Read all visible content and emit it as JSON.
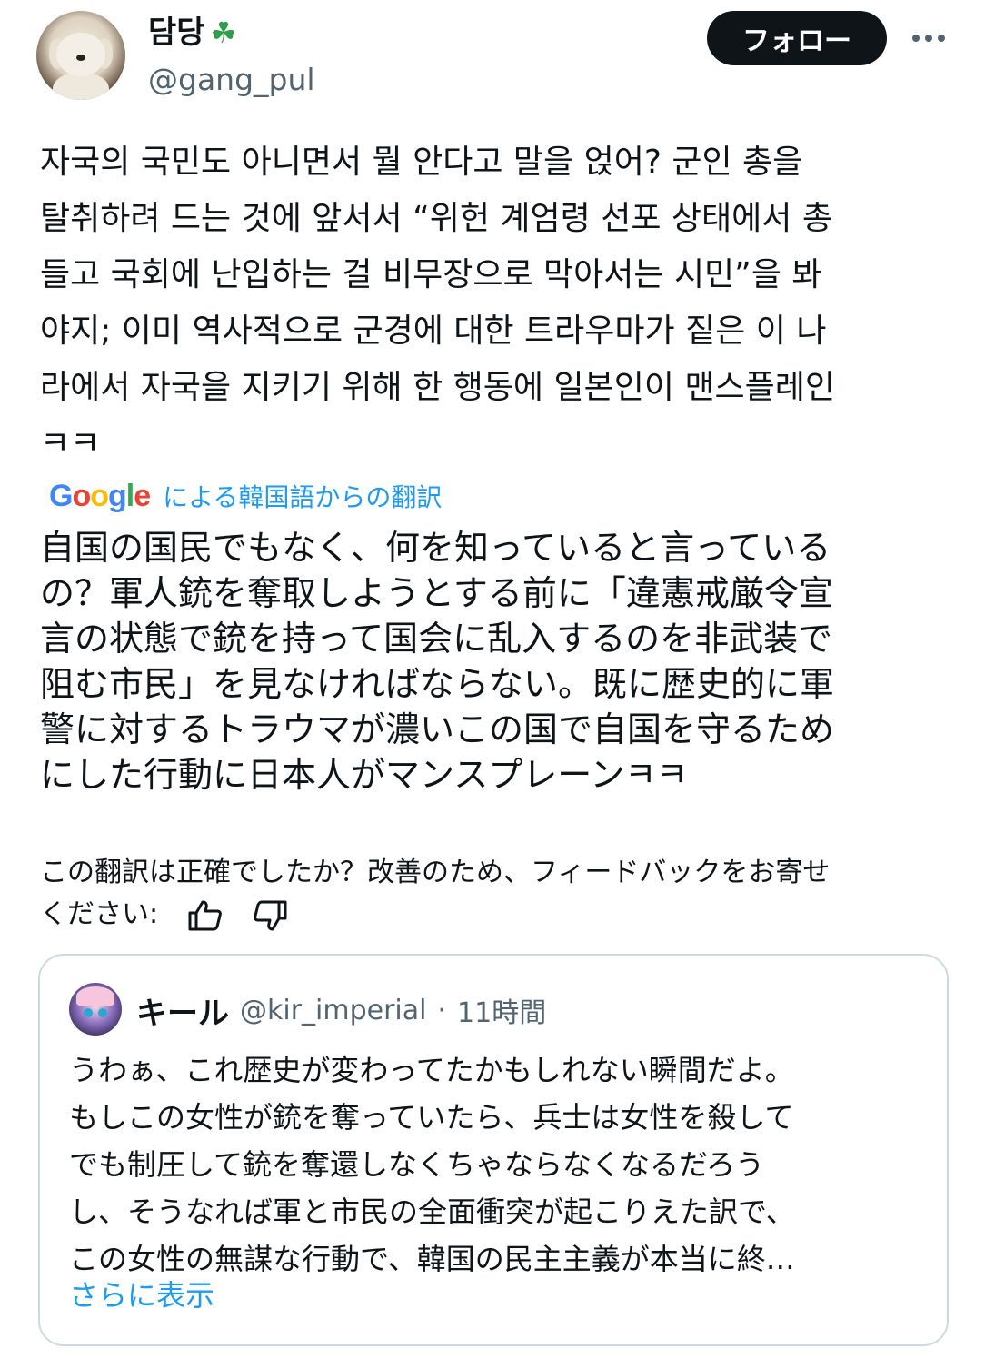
{
  "author": {
    "display_name": "담당",
    "name_emoji": "☘",
    "handle": "@gang_pul",
    "avatar": "avatar-image"
  },
  "actions": {
    "follow_label": "フォロー",
    "more_icon": "more-dots-icon"
  },
  "tweet": {
    "lines": [
      "자국의 국민도 아니면서 뭘 안다고 말을 얹어? 군인 총을",
      "탈취하려 드는 것에 앞서서 “위헌 계엄령 선포 상태에서 총",
      "들고 국회에 난입하는 걸 비무장으로 막아서는 시민”을 봐",
      "야지; 이미 역사적으로 군경에 대한 트라우마가 짙은 이 나",
      "라에서 자국을 지키기 위해 한 행동에 일본인이 맨스플레인",
      "ㅋㅋ"
    ]
  },
  "translation": {
    "provider": "Google",
    "label": "による韓国語からの翻訳",
    "lines": [
      "自国の国民でもなく、何を知っていると言っている",
      "の？軍人銃を奪取しようとする前に「違憲戒厳令宣",
      "言の状態で銃を持って国会に乱入するのを非武装で",
      "阻む市民」を見なければならない。既に歴史的に軍",
      "警に対するトラウマが濃いこの国で自国を守るため",
      "にした行動に日本人がマンスプレーンㅋㅋ"
    ],
    "feedback_line1": "この翻訳は正確でしたか？改善のため、フィードバックをお寄せ",
    "feedback_line2": "ください:",
    "thumbs_up_icon": "thumbs-up-icon",
    "thumbs_down_icon": "thumbs-down-icon"
  },
  "quote": {
    "display_name": "キール",
    "handle": "@kir_imperial",
    "separator": "·",
    "time": "11時間",
    "lines": [
      "うわぁ、これ歴史が変わってたかもしれない瞬間だよ。",
      "もしこの女性が銃を奪っていたら、兵士は女性を殺して",
      "でも制圧して銃を奪還しなくちゃならなくなるだろう",
      "し、そうなれば軍と市民の全面衝突が起こりえた訳で、",
      "この女性の無謀な行動で、韓国の民主主義が本当に終…"
    ],
    "show_more": "さらに表示"
  },
  "colors": {
    "text": "#0f1419",
    "secondary": "#536471",
    "link": "#1d9bf0",
    "button_bg": "#0f1419",
    "border": "#cfd9de"
  }
}
